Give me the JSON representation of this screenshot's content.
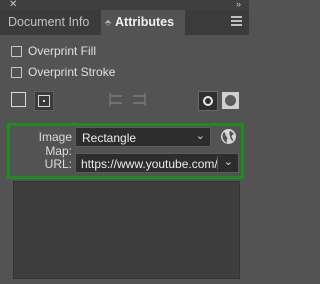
{
  "window": {
    "close_glyph": "✕",
    "collapse_glyph": "»"
  },
  "tabs": {
    "document_info": "Document Info",
    "attributes": "Attributes",
    "attributes_toggle_glyph": "⬘",
    "menu_icon": "hamburger-menu-icon"
  },
  "options": {
    "overprint_fill": {
      "label": "Overprint Fill",
      "checked": false
    },
    "overprint_stroke": {
      "label": "Overprint Stroke",
      "checked": false
    }
  },
  "icons": {
    "show_center_off": "square-outline-icon",
    "show_center_on": "square-center-dot-icon",
    "reverse_path_1": "reverse-path-direction-icon",
    "reverse_path_2": "reverse-path-direction-alt-icon",
    "nonzero_fill": "nonzero-winding-fill-icon",
    "evenodd_fill": "even-odd-fill-icon"
  },
  "image_map": {
    "label": "Image Map:",
    "value": "Rectangle",
    "browser_icon": "globe-icon"
  },
  "url": {
    "label": "URL:",
    "value": "https://www.youtube.com/"
  },
  "notes": {
    "value": ""
  },
  "colors": {
    "panel_bg": "#535353",
    "highlight_border": "#1b8f1b"
  }
}
